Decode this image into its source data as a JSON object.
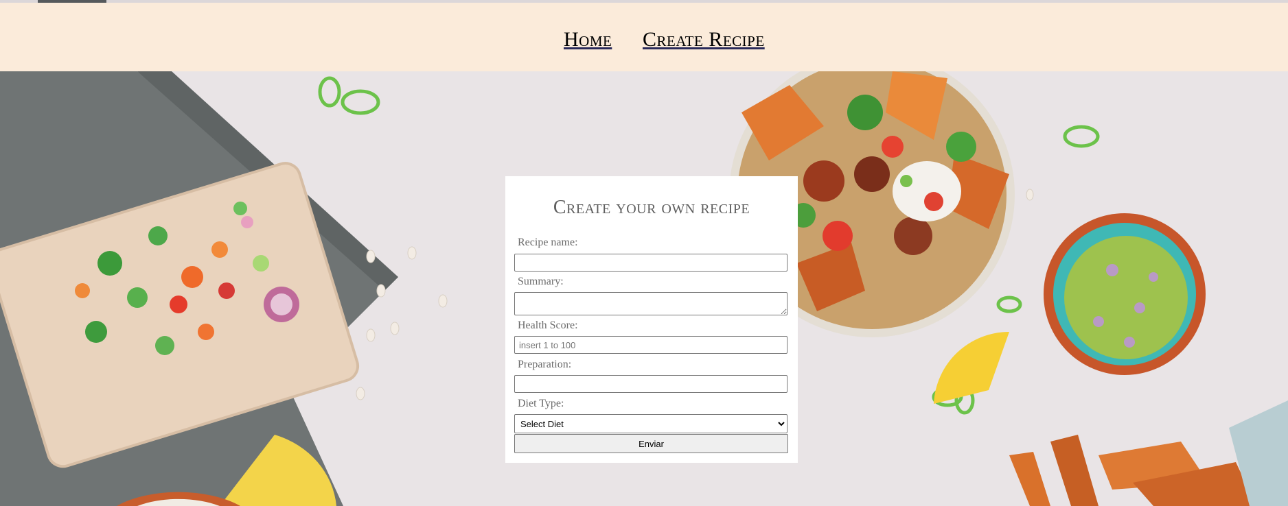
{
  "nav": {
    "home": "Home",
    "create": "Create Recipe"
  },
  "form": {
    "title": "Create your own recipe",
    "name_label": "Recipe name:",
    "name_value": "",
    "summary_label": "Summary:",
    "summary_value": "",
    "health_label": "Health Score:",
    "health_placeholder": "insert 1 to 100",
    "prep_label": "Preparation:",
    "prep_value": "",
    "diet_label": "Diet Type:",
    "diet_selected": "Select Diet",
    "submit_label": "Enviar"
  },
  "colors": {
    "nav_bg": "#fbebda",
    "page_bg": "#e9e4e6",
    "card_bg": "#ffffff"
  },
  "background_image": "food-tabletop-photo"
}
